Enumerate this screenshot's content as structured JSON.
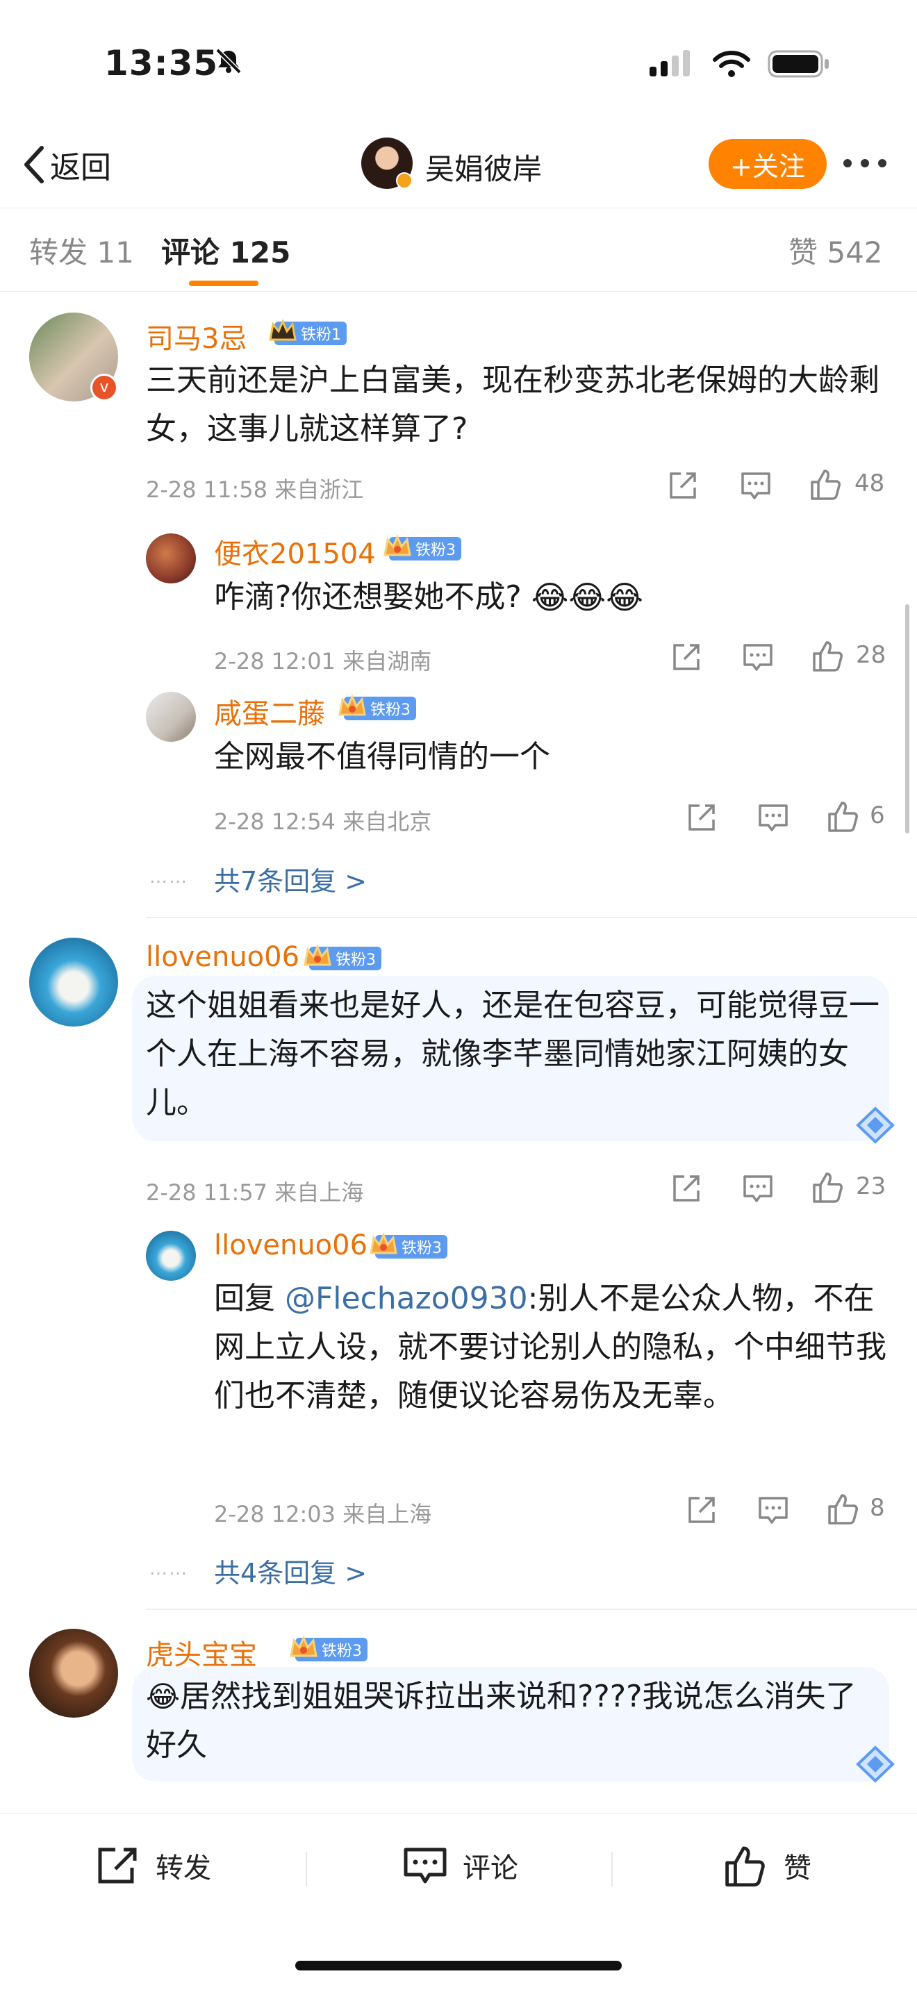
{
  "status_bar": {
    "time": "13:35"
  },
  "nav": {
    "back_label": "返回",
    "title": "吴娟彼岸",
    "follow_label": "+关注"
  },
  "tabs": {
    "repost": "转发 11",
    "comment": "评论 125",
    "like": "赞 542"
  },
  "comments": [
    {
      "user": "司马3忌",
      "badge": "铁粉1",
      "text": "三天前还是沪上白富美，现在秒变苏北老保姆的大龄剩女，这事儿就这样算了?",
      "meta": "2-28 11:58  来自浙江",
      "likes": "48",
      "replies": [
        {
          "user": "便衣201504",
          "badge": "铁粉3",
          "text": "咋滴?你还想娶她不成?",
          "meta": "2-28 12:01  来自湖南",
          "likes": "28"
        },
        {
          "user": "咸蛋二藤",
          "badge": "铁粉3",
          "text": "全网最不值得同情的一个",
          "meta": "2-28 12:54  来自北京",
          "likes": "6"
        }
      ],
      "more": "共7条回复 >"
    },
    {
      "user": "llovenuo06",
      "badge": "铁粉3",
      "text": "这个姐姐看来也是好人，还是在包容豆，可能觉得豆一个人在上海不容易，就像李芊墨同情她家江阿姨的女儿。",
      "meta": "2-28 11:57  来自上海",
      "likes": "23",
      "replies": [
        {
          "user": "llovenuo06",
          "badge": "铁粉3",
          "reply_prefix": "回复 ",
          "mention": "@Flechazo0930",
          "text": ":别人不是公众人物，不在网上立人设，就不要讨论别人的隐私，个中细节我们也不清楚，随便议论容易伤及无辜。",
          "meta": "2-28 12:03  来自上海",
          "likes": "8"
        }
      ],
      "more": "共4条回复 >"
    },
    {
      "user": "虎头宝宝_",
      "badge": "铁粉3",
      "text": "居然找到姐姐哭诉拉出来说和????我说怎么消失了好久"
    }
  ],
  "more_dots": "……",
  "bottom_bar": {
    "repost": "转发",
    "comment": "评论",
    "like": "赞"
  },
  "colors": {
    "accent": "#ff8200",
    "username": "#e8710a",
    "link": "#3b6ea5",
    "badge": "#5d9bf0"
  }
}
